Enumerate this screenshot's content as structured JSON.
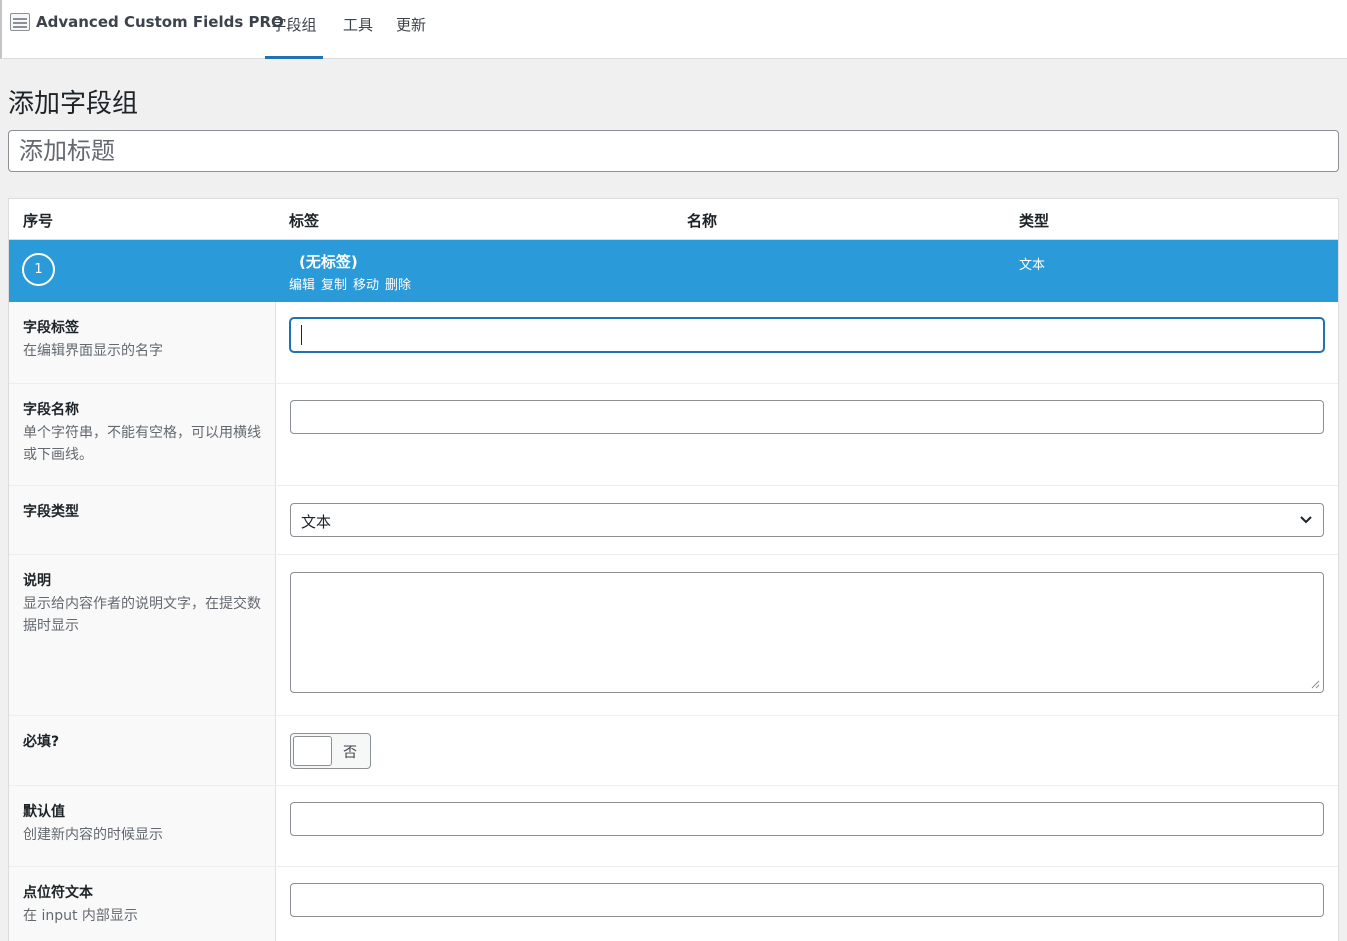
{
  "app": {
    "brand_name": "Advanced Custom Fields PRO",
    "nav_tabs": [
      {
        "label": "字段组",
        "active": true
      },
      {
        "label": "工具",
        "active": false
      },
      {
        "label": "更新",
        "active": false
      }
    ]
  },
  "page": {
    "title": "添加字段组",
    "title_placeholder": "添加标题"
  },
  "fields_table": {
    "headers": {
      "order": "序号",
      "label": "标签",
      "name": "名称",
      "type": "类型"
    },
    "rows": [
      {
        "order": "1",
        "label": "(无标签)",
        "type": "文本",
        "actions": [
          "编辑",
          "复制",
          "移动",
          "删除"
        ]
      }
    ]
  },
  "settings": {
    "field_label": {
      "title": "字段标签",
      "desc": "在编辑界面显示的名字",
      "value": ""
    },
    "field_name": {
      "title": "字段名称",
      "desc": "单个字符串，不能有空格，可以用横线或下画线。",
      "value": ""
    },
    "field_type": {
      "title": "字段类型",
      "value": "文本"
    },
    "instructions": {
      "title": "说明",
      "desc": "显示给内容作者的说明文字，在提交数据时显示",
      "value": ""
    },
    "required": {
      "title": "必填?",
      "toggle_label": "否",
      "value": false
    },
    "default_value": {
      "title": "默认值",
      "desc": "创建新内容的时候显示",
      "value": ""
    },
    "placeholder": {
      "title": "点位符文本",
      "desc": "在 input 内部显示",
      "value": ""
    }
  },
  "colors": {
    "accent": "#2a9ad8",
    "active_tab_underline": "#2271b1",
    "background": "#f0f0f1"
  },
  "icons": [
    "acf-logo-icon",
    "chevron-down-icon",
    "resize-handle-icon"
  ]
}
